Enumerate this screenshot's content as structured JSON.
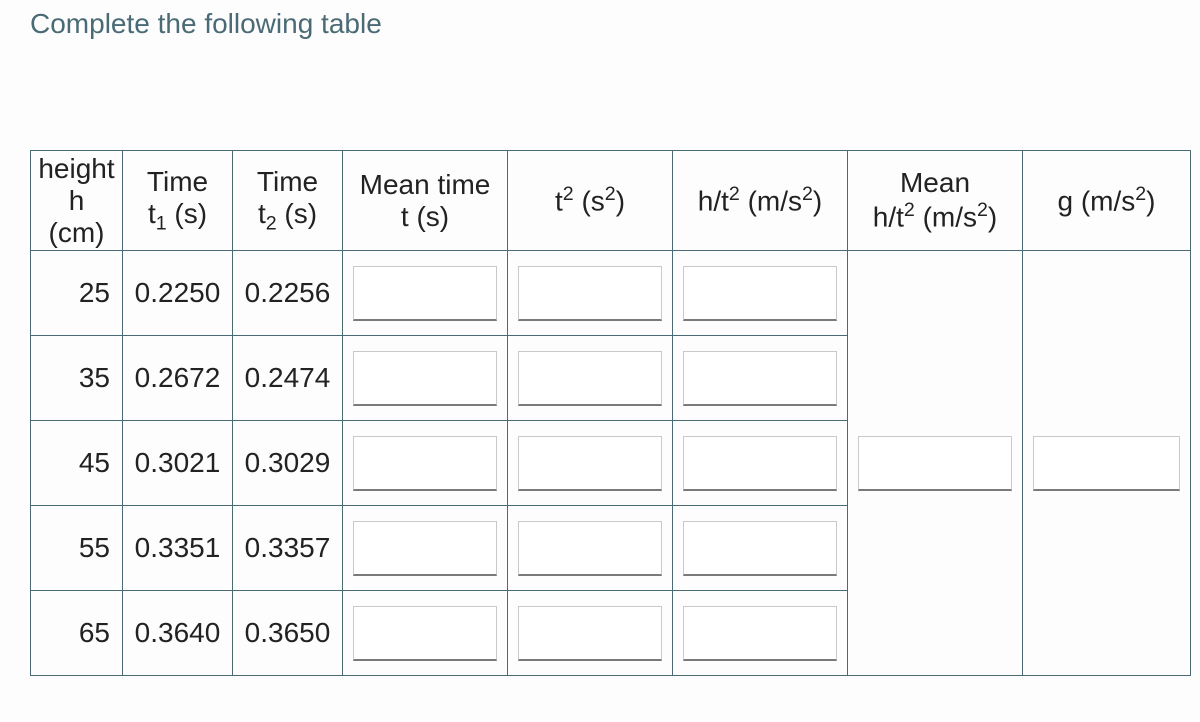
{
  "instruction": "Complete the following table",
  "headers": {
    "h_line1": "height",
    "h_line2": "h",
    "h_line3": "(cm)",
    "t1_line1": "Time",
    "t1_line2_pre": "t",
    "t1_line2_sub": "1",
    "t1_line2_post": " (s)",
    "t2_line1": "Time",
    "t2_line2_pre": "t",
    "t2_line2_sub": "2",
    "t2_line2_post": " (s)",
    "meant_line1": "Mean time",
    "meant_line2": "t (s)",
    "tsq_pre": "t",
    "tsq_sup": "2",
    "tsq_post": " (s",
    "tsq_sup2": "2",
    "tsq_close": ")",
    "ht2_pre": "h/t",
    "ht2_sup": "2",
    "ht2_post": " (m/s",
    "ht2_sup2": "2",
    "ht2_close": ")",
    "meanht2_line1": "Mean",
    "meanht2_pre": "h/t",
    "meanht2_sup": "2",
    "meanht2_post": " (m/s",
    "meanht2_sup2": "2",
    "meanht2_close": ")",
    "g_pre": "g (m/s",
    "g_sup": "2",
    "g_close": ")"
  },
  "rows": [
    {
      "h": "25",
      "t1": "0.2250",
      "t2": "0.2256"
    },
    {
      "h": "35",
      "t1": "0.2672",
      "t2": "0.2474"
    },
    {
      "h": "45",
      "t1": "0.3021",
      "t2": "0.3029"
    },
    {
      "h": "55",
      "t1": "0.3351",
      "t2": "0.3357"
    },
    {
      "h": "65",
      "t1": "0.3640",
      "t2": "0.3650"
    }
  ],
  "chart_data": {
    "type": "table",
    "title": "Complete the following table",
    "columns": [
      "height h (cm)",
      "Time t1 (s)",
      "Time t2 (s)",
      "Mean time t (s)",
      "t² (s²)",
      "h/t² (m/s²)",
      "Mean h/t² (m/s²)",
      "g (m/s²)"
    ],
    "rows": [
      [
        25,
        0.225,
        0.2256,
        null,
        null,
        null,
        null,
        null
      ],
      [
        35,
        0.2672,
        0.2474,
        null,
        null,
        null,
        null,
        null
      ],
      [
        45,
        0.3021,
        0.3029,
        null,
        null,
        null,
        null,
        null
      ],
      [
        55,
        0.3351,
        0.3357,
        null,
        null,
        null,
        null,
        null
      ],
      [
        65,
        0.364,
        0.365,
        null,
        null,
        null,
        null,
        null
      ]
    ]
  }
}
